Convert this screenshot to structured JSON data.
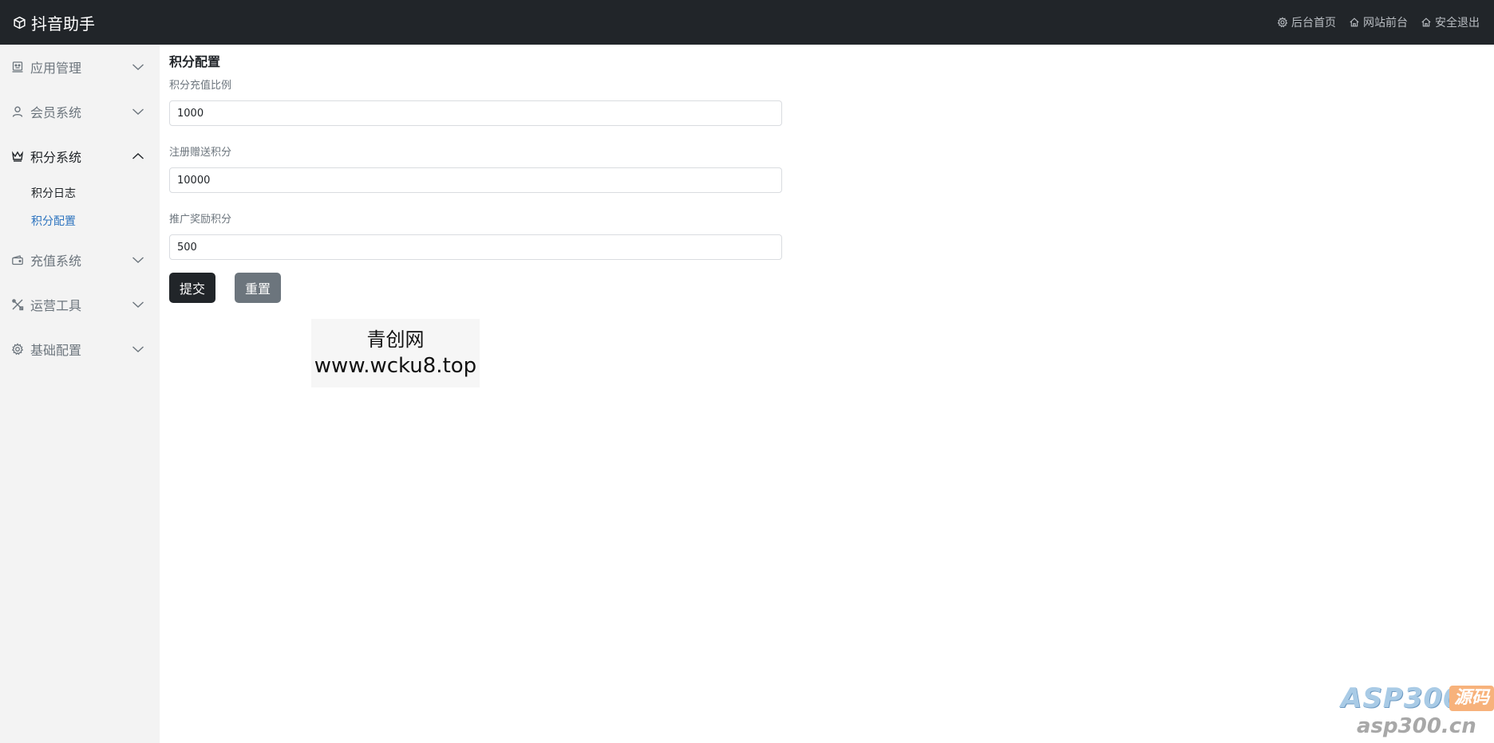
{
  "header": {
    "brand": "抖音助手",
    "links": [
      {
        "label": "后台首页",
        "icon": "gear-icon"
      },
      {
        "label": "网站前台",
        "icon": "home-icon"
      },
      {
        "label": "安全退出",
        "icon": "home-icon"
      }
    ]
  },
  "sidebar": {
    "groups": [
      {
        "label": "应用管理",
        "icon": "robot-icon",
        "open": false
      },
      {
        "label": "会员系统",
        "icon": "user-icon",
        "open": false
      },
      {
        "label": "积分系统",
        "icon": "crown-icon",
        "open": true,
        "items": [
          {
            "label": "积分日志",
            "active": false
          },
          {
            "label": "积分配置",
            "active": true
          }
        ]
      },
      {
        "label": "充值系统",
        "icon": "wallet-icon",
        "open": false
      },
      {
        "label": "运营工具",
        "icon": "tools-icon",
        "open": false
      },
      {
        "label": "基础配置",
        "icon": "gear-icon",
        "open": false
      }
    ]
  },
  "main": {
    "title": "积分配置",
    "fields": [
      {
        "label": "积分充值比例",
        "value": "1000"
      },
      {
        "label": "注册赠送积分",
        "value": "10000"
      },
      {
        "label": "推广奖励积分",
        "value": "500"
      }
    ],
    "buttons": {
      "submit": "提交",
      "reset": "重置"
    }
  },
  "watermark": {
    "line1": "青创网",
    "line2": "www.wcku8.top"
  },
  "corner_logo": {
    "main": "ASP300",
    "badge": "源码",
    "sub": "asp300.cn"
  },
  "colors": {
    "topbar": "#212529",
    "sidebar": "#f3f3f3",
    "active_link": "#2e74bf",
    "submit_button": "#212529",
    "reset_button": "#6c757d"
  }
}
